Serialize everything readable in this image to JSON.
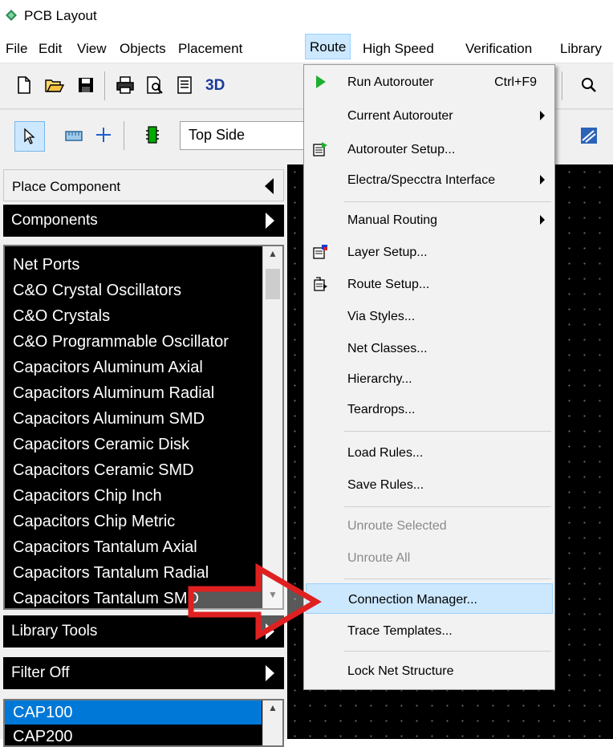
{
  "window": {
    "title": "PCB Layout"
  },
  "menubar": {
    "items": [
      "File",
      "Edit",
      "View",
      "Objects",
      "Placement",
      "Route",
      "High Speed",
      "Verification",
      "Library"
    ],
    "open_item": "Route"
  },
  "toolbar1": {
    "threed_label": "3D"
  },
  "toolbar2": {
    "side_select": "Top Side"
  },
  "left_panel": {
    "place_component": "Place Component",
    "components": "Components",
    "components_list": [
      "Net Ports",
      "C&O Crystal Oscillators",
      "C&O Crystals",
      "C&O Programmable Oscillator",
      "Capacitors Aluminum Axial",
      "Capacitors Aluminum Radial",
      "Capacitors Aluminum SMD",
      "Capacitors Ceramic Disk",
      "Capacitors Ceramic SMD",
      "Capacitors Chip Inch",
      "Capacitors Chip Metric",
      "Capacitors Tantalum Axial",
      "Capacitors Tantalum Radial",
      "Capacitors Tantalum SMD"
    ],
    "library_tools": "Library Tools",
    "filter": "Filter Off",
    "parts_list": [
      "CAP100",
      "CAP200"
    ],
    "selected_part": "CAP100"
  },
  "route_menu": {
    "run_autorouter": "Run Autorouter",
    "run_autorouter_shortcut": "Ctrl+F9",
    "current_autorouter": "Current Autorouter",
    "autorouter_setup": "Autorouter Setup...",
    "electra_interface": "Electra/Specctra Interface",
    "manual_routing": "Manual Routing",
    "layer_setup": "Layer Setup...",
    "route_setup": "Route Setup...",
    "via_styles": "Via Styles...",
    "net_classes": "Net Classes...",
    "hierarchy": "Hierarchy...",
    "teardrops": "Teardrops...",
    "load_rules": "Load Rules...",
    "save_rules": "Save Rules...",
    "unroute_selected": "Unroute Selected",
    "unroute_all": "Unroute All",
    "connection_manager": "Connection Manager...",
    "trace_templates": "Trace Templates...",
    "lock_net_structure": "Lock Net Structure"
  },
  "colors": {
    "menu_highlight": "#cce8ff",
    "list_background": "#000000",
    "selection": "#0078d7",
    "annotation_arrow": "#e02020"
  }
}
